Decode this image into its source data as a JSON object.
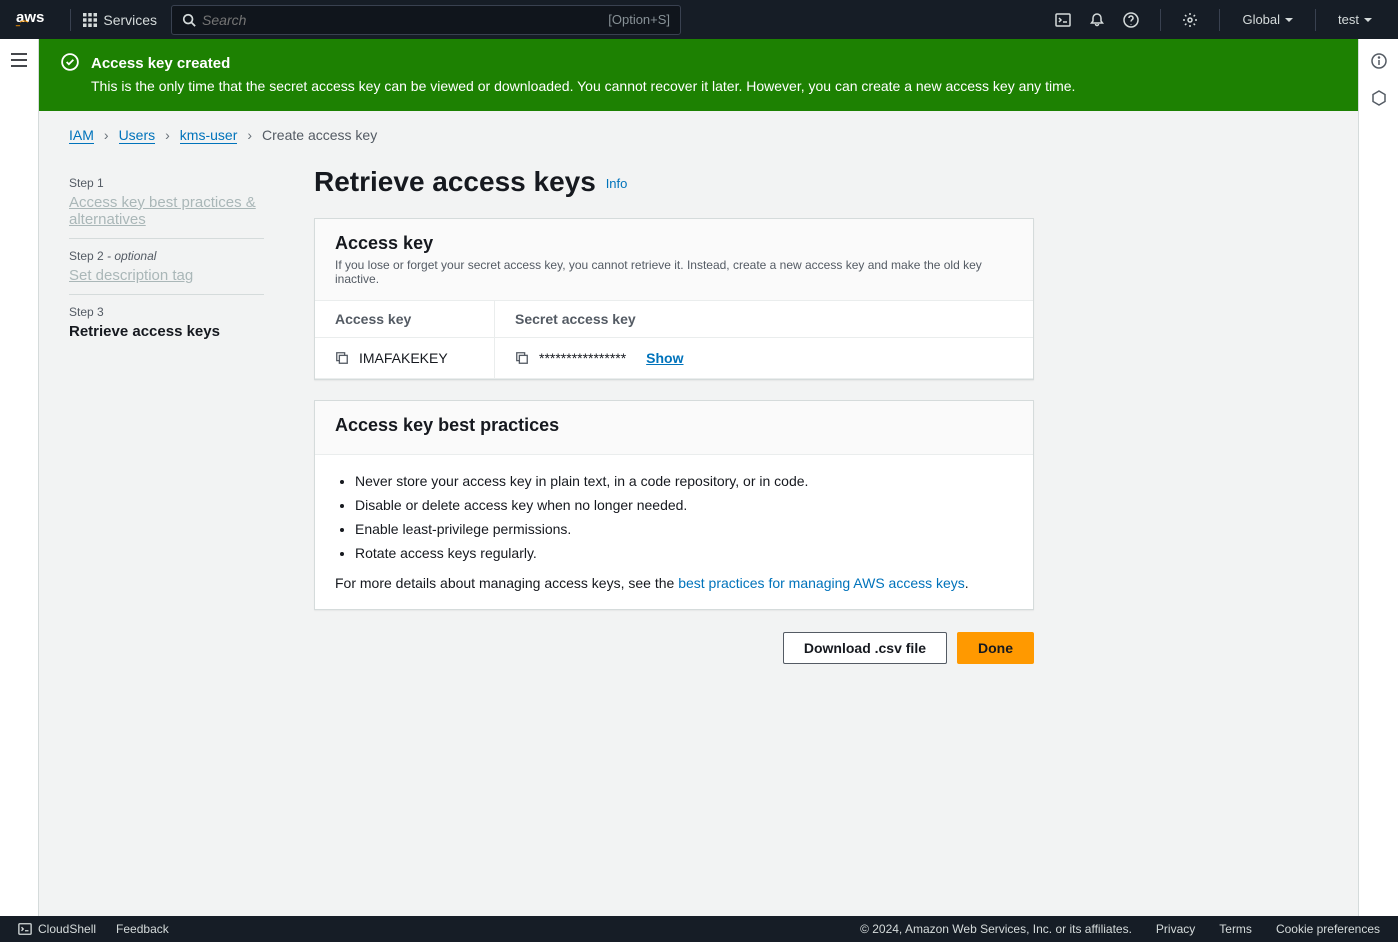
{
  "nav": {
    "services_label": "Services",
    "search_placeholder": "Search",
    "search_kbd": "[Option+S]",
    "region": "Global",
    "account": "test"
  },
  "flash": {
    "title": "Access key created",
    "message": "This is the only time that the secret access key can be viewed or downloaded. You cannot recover it later. However, you can create a new access key any time."
  },
  "breadcrumbs": {
    "iam": "IAM",
    "users": "Users",
    "user": "kms-user",
    "current": "Create access key"
  },
  "steps": {
    "s1_num": "Step 1",
    "s1_title": "Access key best practices & alternatives",
    "s2_num": "Step 2",
    "s2_opt": "- optional",
    "s2_title": "Set description tag",
    "s3_num": "Step 3",
    "s3_title": "Retrieve access keys"
  },
  "page": {
    "title": "Retrieve access keys",
    "info": "Info"
  },
  "key_panel": {
    "title": "Access key",
    "subtitle": "If you lose or forget your secret access key, you cannot retrieve it. Instead, create a new access key and make the old key inactive.",
    "col1": "Access key",
    "col2": "Secret access key",
    "access_key": "IMAFAKEKEY",
    "secret_masked": "****************",
    "show_label": "Show"
  },
  "bp_panel": {
    "title": "Access key best practices",
    "items": [
      "Never store your access key in plain text, in a code repository, or in code.",
      "Disable or delete access key when no longer needed.",
      "Enable least-privilege permissions.",
      "Rotate access keys regularly."
    ],
    "more_prefix": "For more details about managing access keys, see the ",
    "more_link": "best practices for managing AWS access keys",
    "more_suffix": "."
  },
  "buttons": {
    "download": "Download .csv file",
    "done": "Done"
  },
  "footer": {
    "cloudshell": "CloudShell",
    "feedback": "Feedback",
    "copyright": "© 2024, Amazon Web Services, Inc. or its affiliates.",
    "privacy": "Privacy",
    "terms": "Terms",
    "cookies": "Cookie preferences"
  }
}
